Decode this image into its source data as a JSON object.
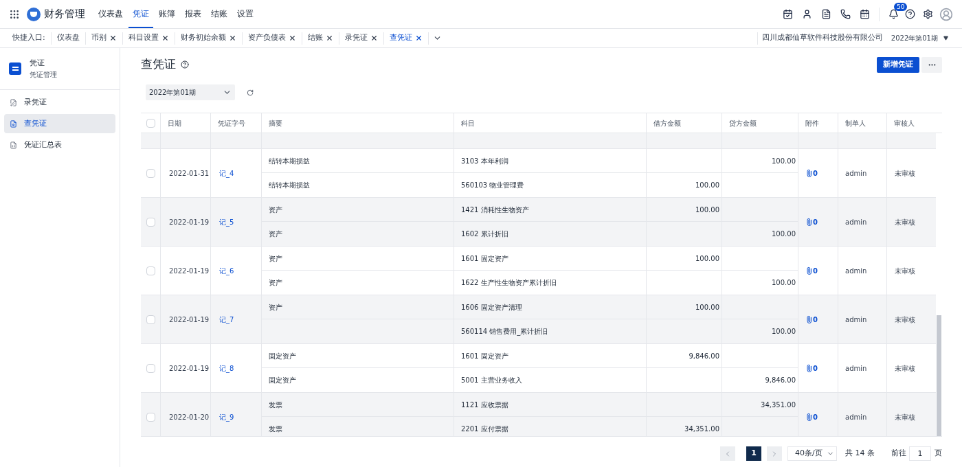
{
  "app": {
    "title": "财务管理"
  },
  "nav": [
    {
      "label": "仪表盘",
      "selected": false
    },
    {
      "label": "凭证",
      "selected": true
    },
    {
      "label": "账簿",
      "selected": false
    },
    {
      "label": "报表",
      "selected": false
    },
    {
      "label": "结账",
      "selected": false
    },
    {
      "label": "设置",
      "selected": false
    }
  ],
  "notifications": {
    "count": "50"
  },
  "shortcuts": {
    "label": "快捷入口:",
    "items": [
      {
        "label": "仪表盘",
        "closable": false,
        "selected": false
      },
      {
        "label": "币别",
        "closable": true,
        "selected": false
      },
      {
        "label": "科目设置",
        "closable": true,
        "selected": false
      },
      {
        "label": "财务初始余额",
        "closable": true,
        "selected": false
      },
      {
        "label": "资产负债表",
        "closable": true,
        "selected": false
      },
      {
        "label": "结账",
        "closable": true,
        "selected": false
      },
      {
        "label": "录凭证",
        "closable": true,
        "selected": false
      },
      {
        "label": "查凭证",
        "closable": true,
        "selected": true
      }
    ],
    "company": "四川成都仙草软件科技股份有限公司",
    "period": "2022年第01期"
  },
  "sidebar": {
    "title": "凭证",
    "subtitle": "凭证管理",
    "items": [
      {
        "label": "录凭证",
        "selected": false
      },
      {
        "label": "查凭证",
        "selected": true
      },
      {
        "label": "凭证汇总表",
        "selected": false
      }
    ]
  },
  "page": {
    "title": "查凭证",
    "primary_button": "新增凭证",
    "period_select": "2022年第01期"
  },
  "table": {
    "columns": [
      "日期",
      "凭证字号",
      "摘要",
      "科目",
      "借方金额",
      "贷方金额",
      "附件",
      "制单人",
      "审核人"
    ],
    "all_checked": false,
    "vouchers": [
      {
        "checked": false,
        "date": "2022-01-31",
        "number": "记_4",
        "entries": [
          {
            "summary": "结转本期损益",
            "subject": "3103 本年利润",
            "credit": "100.00"
          },
          {
            "summary": "结转本期损益",
            "subject": "560103 物业管理费",
            "debit": "100.00"
          }
        ],
        "attachments": "0",
        "maker": "admin",
        "auditor": "未审核"
      },
      {
        "checked": false,
        "date": "2022-01-19",
        "number": "记_5",
        "entries": [
          {
            "summary": "资产",
            "subject": "1421 消耗性生物资产",
            "debit": "100.00"
          },
          {
            "summary": "资产",
            "subject": "1602 累计折旧",
            "credit": "100.00"
          }
        ],
        "attachments": "0",
        "maker": "admin",
        "auditor": "未审核"
      },
      {
        "checked": false,
        "date": "2022-01-19",
        "number": "记_6",
        "entries": [
          {
            "summary": "资产",
            "subject": "1601 固定资产",
            "debit": "100.00"
          },
          {
            "summary": "资产",
            "subject": "1622 生产性生物资产累计折旧",
            "credit": "100.00"
          }
        ],
        "attachments": "0",
        "maker": "admin",
        "auditor": "未审核"
      },
      {
        "checked": false,
        "date": "2022-01-19",
        "number": "记_7",
        "entries": [
          {
            "summary": "资产",
            "subject": "1606 固定资产清理",
            "debit": "100.00"
          },
          {
            "subject": "560114 销售费用_累计折旧",
            "credit": "100.00"
          }
        ],
        "attachments": "0",
        "maker": "admin",
        "auditor": "未审核"
      },
      {
        "checked": false,
        "date": "2022-01-19",
        "number": "记_8",
        "entries": [
          {
            "summary": "固定资产",
            "subject": "1601 固定资产",
            "debit": "9,846.00"
          },
          {
            "summary": "固定资产",
            "subject": "5001 主营业务收入",
            "credit": "9,846.00"
          }
        ],
        "attachments": "0",
        "maker": "admin",
        "auditor": "未审核"
      },
      {
        "checked": false,
        "date": "2022-01-20",
        "number": "记_9",
        "entries": [
          {
            "summary": "发票",
            "subject": "1121 应收票据",
            "credit": "34,351.00"
          },
          {
            "summary": "发票",
            "subject": "2201 应付票据",
            "debit": "34,351.00"
          }
        ],
        "attachments": "0",
        "maker": "admin",
        "auditor": "未审核"
      }
    ]
  },
  "pagination": {
    "pages": [
      {
        "label": "1",
        "selected": true
      }
    ],
    "page_size": "40条/页",
    "total": "共 14 条",
    "goto_label": "前往",
    "goto_value": "1",
    "goto_suffix": "页"
  }
}
